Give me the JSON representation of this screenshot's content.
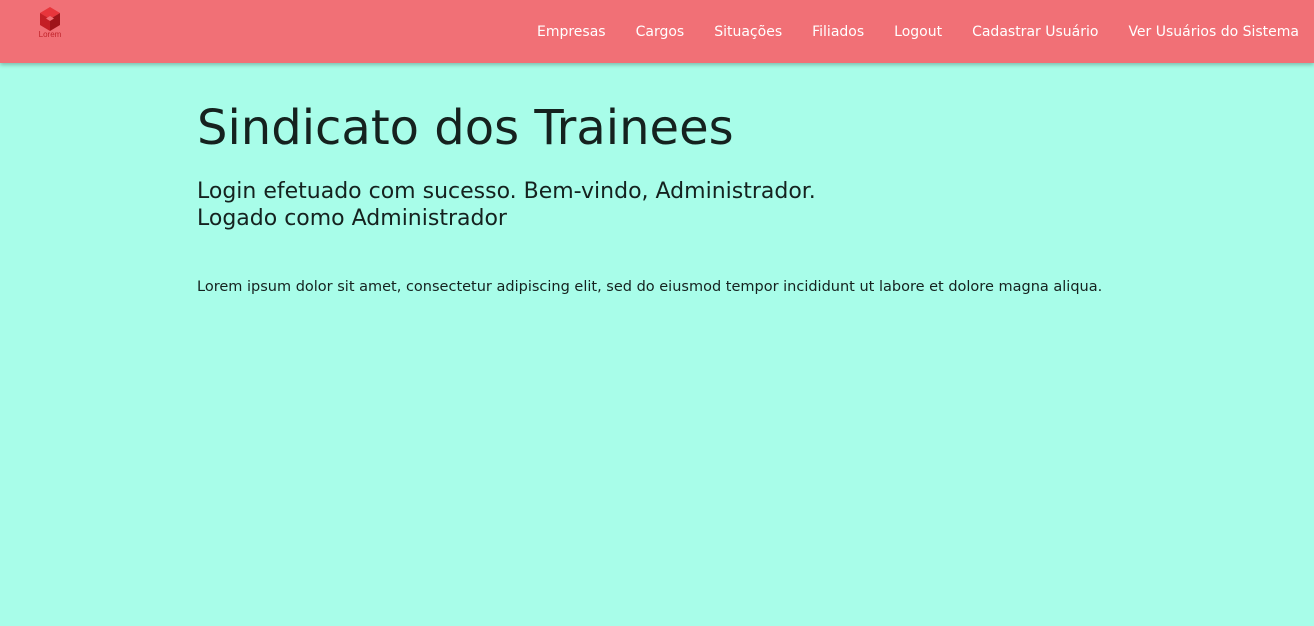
{
  "navbar": {
    "logo_text": "Lorem",
    "links": [
      {
        "label": "Empresas"
      },
      {
        "label": "Cargos"
      },
      {
        "label": "Situações"
      },
      {
        "label": "Filiados"
      },
      {
        "label": "Logout"
      },
      {
        "label": "Cadastrar Usuário"
      },
      {
        "label": "Ver Usuários do Sistema"
      }
    ]
  },
  "main": {
    "title": "Sindicato dos Trainees",
    "login_message": "Login efetuado com sucesso. Bem-vindo, Administrador.",
    "logged_as": "Logado como Administrador",
    "body_text": "Lorem ipsum dolor sit amet, consectetur adipiscing elit, sed do eiusmod tempor incididunt ut labore et dolore magna aliqua."
  },
  "colors": {
    "navbar": "#f17076",
    "background": "#a8fde9",
    "logo": "#d42a2f"
  }
}
